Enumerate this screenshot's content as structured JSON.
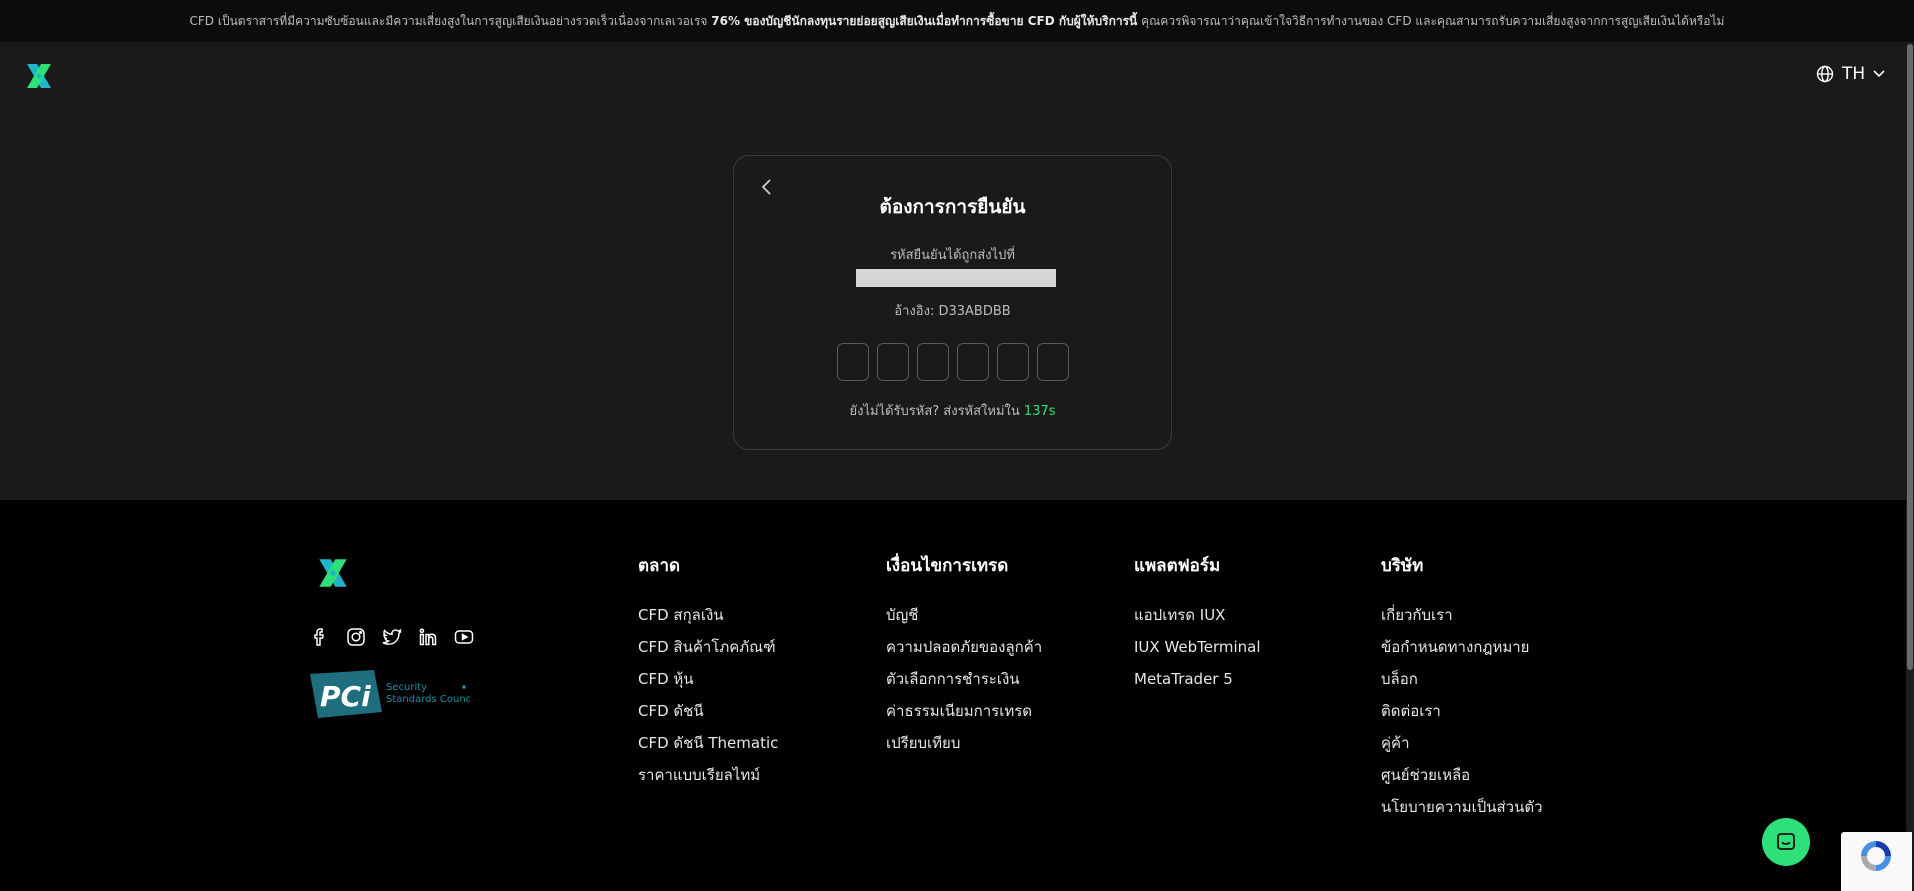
{
  "banner": {
    "part1": "CFD เป็นตราสารที่มีความซับซ้อนและมีความเสี่ยงสูงในการสูญเสียเงินอย่างรวดเร็วเนื่องจากเลเวอเรจ",
    "bold": "76% ของบัญชีนักลงทุนรายย่อยสูญเสียเงินเมื่อทำการซื้อขาย CFD กับผู้ให้บริการนี้",
    "part2": "คุณควรพิจารณาว่าคุณเข้าใจวิธีการทำงานของ CFD และคุณสามารถรับความเสี่ยงสูงจากการสูญเสียเงินได้หรือไม่"
  },
  "header": {
    "lang_code": "TH"
  },
  "verify": {
    "title": "ต้องการการยืนยัน",
    "sent_label": "รหัสยืนยันได้ถูกส่งไปที่",
    "reference": "อ้างอิง: D33ABDBB",
    "otp": [
      "",
      "",
      "",
      "",
      "",
      ""
    ],
    "resend_text": "ยังไม่ได้รับรหัส? ส่งรหัสใหม่ใน",
    "timer": "137s"
  },
  "footer": {
    "pci": {
      "brand": "PCi",
      "line1": "Security",
      "line2": "Standards Council"
    },
    "columns": [
      {
        "title": "ตลาด",
        "links": [
          "CFD สกุลเงิน",
          "CFD สินค้าโภคภัณฑ์",
          "CFD หุ้น",
          "CFD ดัชนี",
          "CFD ดัชนี Thematic",
          "ราคาแบบเรียลไทม์"
        ]
      },
      {
        "title": "เงื่อนไขการเทรด",
        "links": [
          "บัญชี",
          "ความปลอดภัยของลูกค้า",
          "ตัวเลือกการชำระเงิน",
          "ค่าธรรมเนียมการเทรด",
          "เปรียบเทียบ"
        ]
      },
      {
        "title": "แพลตฟอร์ม",
        "links": [
          "แอปเทรด IUX",
          "IUX WebTerminal",
          "MetaTrader 5"
        ]
      },
      {
        "title": "บริษัท",
        "links": [
          "เกี่ยวกับเรา",
          "ข้อกำหนดทางกฎหมาย",
          "บล็อก",
          "ติดต่อเรา",
          "คู่ค้า",
          "ศูนย์ช่วยเหลือ",
          "นโยบายความเป็นส่วนตัว"
        ]
      }
    ]
  },
  "colors": {
    "accent": "#2ee07a",
    "logo_teal": "#1fb6c9",
    "pci": "#1e6e7e"
  }
}
